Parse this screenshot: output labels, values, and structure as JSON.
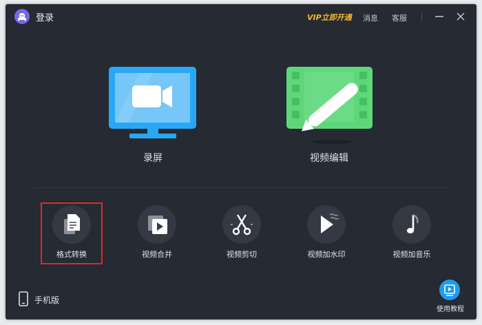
{
  "titlebar": {
    "login_label": "登录",
    "vip_label": "VIP立即开通",
    "messages_label": "消息",
    "service_label": "客服",
    "minimize_icon": "minimize-icon",
    "close_icon": "close-icon"
  },
  "main_features": [
    {
      "label": "录屏",
      "icon": "monitor-camera-icon"
    },
    {
      "label": "视频编辑",
      "icon": "film-pen-icon"
    }
  ],
  "tools": [
    {
      "label": "格式转换",
      "icon": "format-convert-icon",
      "selected": true
    },
    {
      "label": "视频合并",
      "icon": "video-merge-icon"
    },
    {
      "label": "视频剪切",
      "icon": "scissors-icon"
    },
    {
      "label": "视频加水印",
      "icon": "watermark-play-icon"
    },
    {
      "label": "视频加音乐",
      "icon": "music-note-icon"
    }
  ],
  "footer": {
    "mobile_label": "手机版",
    "tutorial_label": "使用教程"
  },
  "colors": {
    "background": "#262a33",
    "vip_accent": "#f5b52e",
    "screen_record_blue": "#2aa7f4",
    "video_edit_green": "#5ed77a",
    "selection_red": "#e0282a",
    "tutorial_blue": "#1f9bf0"
  }
}
